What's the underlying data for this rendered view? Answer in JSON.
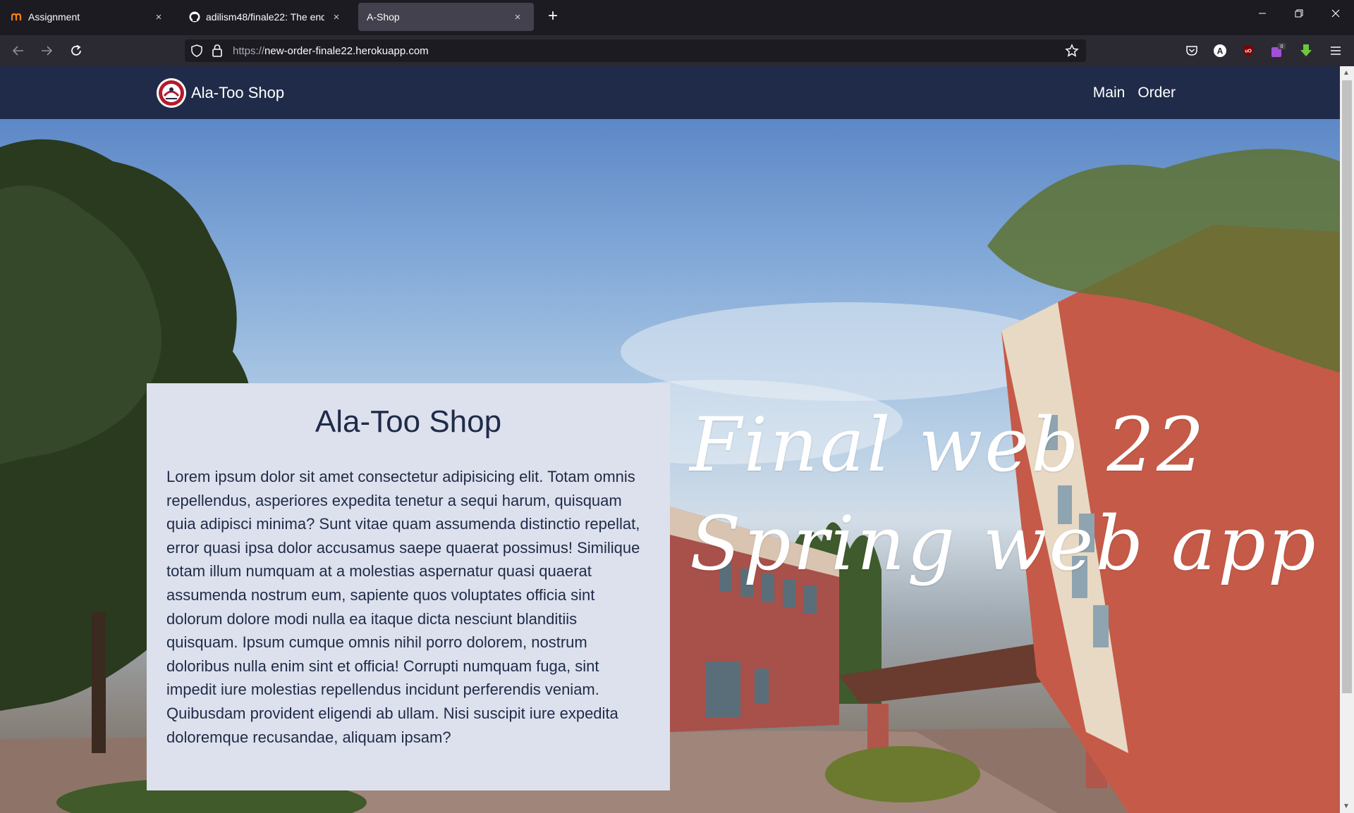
{
  "browser": {
    "tabs": [
      {
        "title": "Assignment",
        "icon": "moodle-icon",
        "active": false
      },
      {
        "title": "adilism48/finale22: The end",
        "icon": "github-icon",
        "active": false
      },
      {
        "title": "A-Shop",
        "icon": "none",
        "active": true
      }
    ],
    "new_tab_symbol": "+",
    "close_symbol": "×",
    "url": {
      "scheme": "https://",
      "host": "new-order-finale22.herokuapp.com"
    },
    "window_controls": [
      "minimize-icon",
      "restore-icon",
      "close-icon"
    ],
    "extension_badge": "0"
  },
  "site": {
    "brand": "Ala-Too Shop",
    "nav": {
      "main": "Main",
      "order": "Order"
    },
    "card": {
      "title": "Ala-Too Shop",
      "body": "Lorem ipsum dolor sit amet consectetur adipisicing elit. Totam omnis repellendus, asperiores expedita tenetur a sequi harum, quisquam quia adipisci minima? Sunt vitae quam assumenda distinctio repellat, error quasi ipsa dolor accusamus saepe quaerat possimus! Similique totam illum numquam at a molestias aspernatur quasi quaerat assumenda nostrum eum, sapiente quos voluptates officia sint dolorum dolore modi nulla ea itaque dicta nesciunt blanditiis quisquam. Ipsum cumque omnis nihil porro dolorem, nostrum doloribus nulla enim sint et officia! Corrupti numquam fuga, sint impedit iure molestias repellendus incidunt perferendis veniam. Quibusdam provident eligendi ab ullam. Nisi suscipit iure expedita doloremque recusandae, aliquam ipsam?"
    },
    "tagline": {
      "line1": "Final web 22",
      "line2": "Spring web app"
    }
  },
  "colors": {
    "header_bg": "#1f2b48",
    "card_bg": "#dde1ed",
    "card_text": "#1f2b48",
    "browser_bg": "#1c1b22",
    "toolbar_bg": "#2b2a33"
  }
}
